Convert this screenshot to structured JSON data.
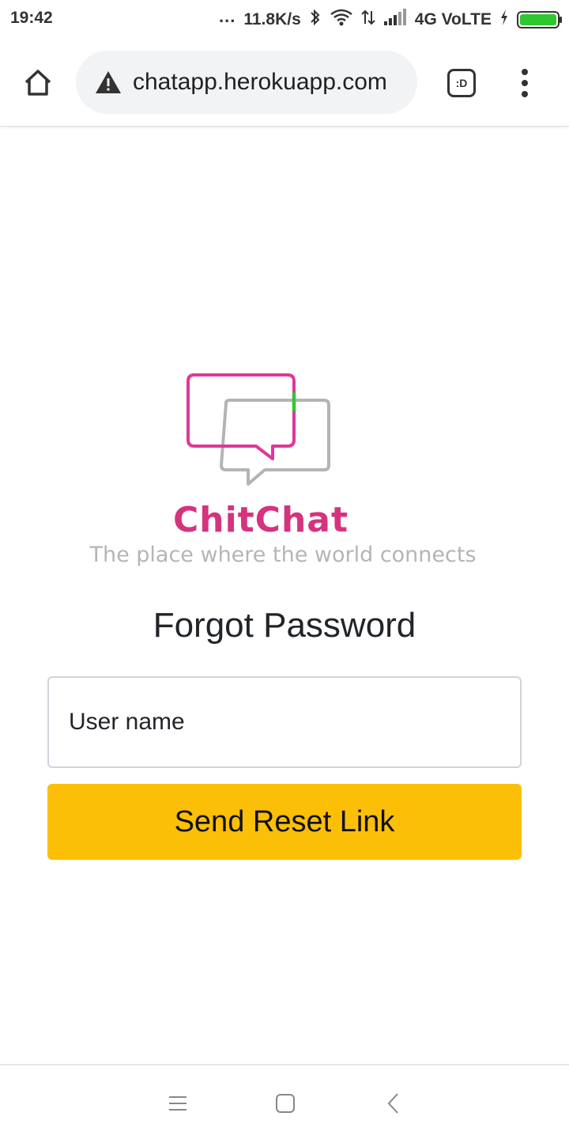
{
  "status_bar": {
    "time": "19:42",
    "dots": "...",
    "speed": "11.8K/s",
    "network": "4G VoLTE",
    "icons": [
      "bluetooth-icon",
      "wifi-icon",
      "data-arrows-icon",
      "signal-icon",
      "charging-icon",
      "battery-icon"
    ],
    "battery_color": "#2fc72f"
  },
  "browser": {
    "url": "chatapp.herokuapp.com",
    "tab_label": ":D",
    "icons": [
      "home-icon",
      "warning-icon",
      "menu-icon"
    ]
  },
  "brand": {
    "name": "ChitChat",
    "tagline": "The place where the world connects",
    "colors": {
      "primary_bubble": "#e0379a",
      "secondary_bubble": "#b4b4b4",
      "accent": "#35c535"
    }
  },
  "form": {
    "title": "Forgot Password",
    "username_placeholder": "User name",
    "username_value": "",
    "submit_label": "Send Reset Link",
    "button_color": "#fcbf08"
  },
  "nav": {
    "icons": [
      "recents-icon",
      "home-square-icon",
      "back-icon"
    ]
  }
}
